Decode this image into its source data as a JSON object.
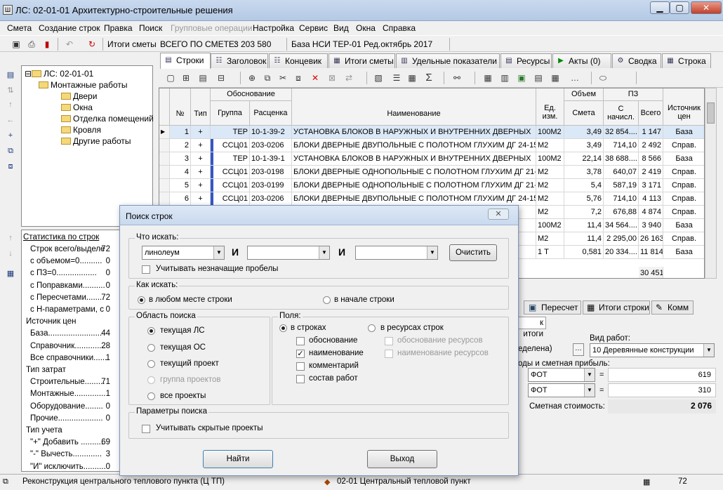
{
  "window": {
    "title": "ЛС: 02-01-01 Архитектурно-строительные решения"
  },
  "menu": [
    "Смета",
    "Создание строк",
    "Правка",
    "Поиск",
    "Групповые операции",
    "Настройка",
    "Сервис",
    "Вид",
    "Окна",
    "Справка"
  ],
  "toolbar": {
    "totals_label": "Итоги сметы",
    "total_caption": "ВСЕГО ПО СМЕТЕ:",
    "total_value": "3 203 580",
    "base_label": "База НСИ",
    "base_value": "ТЕР-01 Ред.октябрь 2017"
  },
  "tabs": [
    "Строки",
    "Заголовок",
    "Концевик",
    "Итоги сметы",
    "Удельные показатели",
    "Ресурсы",
    "Акты (0)",
    "Сводка",
    "Строка"
  ],
  "tree": {
    "root": "ЛС: 02-01-01",
    "group": "Монтажные работы",
    "items": [
      "Двери",
      "Окна",
      "Отделка помещений",
      "Кровля",
      "Другие работы"
    ]
  },
  "stats": {
    "title": "Статистика по строк",
    "rows": [
      {
        "label": "Строк всего/выделе",
        "value": "72"
      },
      {
        "label": "с объемом=0..........",
        "value": "0"
      },
      {
        "label": "с ПЗ=0..................",
        "value": "0"
      },
      {
        "label": "с Поправками..........",
        "value": "0"
      },
      {
        "label": "с Пересчетами........",
        "value": "72"
      },
      {
        "label": "с Н-параметрами, с",
        "value": "0"
      },
      {
        "label": "Источник цен",
        "value": ""
      },
      {
        "label": "База........................",
        "value": "44"
      },
      {
        "label": "Справочник..............",
        "value": "28"
      },
      {
        "label": "Все справочники......",
        "value": "1"
      },
      {
        "label": "Тип затрат",
        "value": ""
      },
      {
        "label": "Строительные.........",
        "value": "71"
      },
      {
        "label": "Монтажные..............",
        "value": "1"
      },
      {
        "label": "Оборудование........",
        "value": "0"
      },
      {
        "label": "Прочие....................",
        "value": "0"
      },
      {
        "label": "Тип учета",
        "value": ""
      },
      {
        "label": "\"+\" Добавить ..........",
        "value": "69"
      },
      {
        "label": "\"-\" Вычесть.............",
        "value": "3"
      },
      {
        "label": "\"И\" исключить..........",
        "value": "0"
      }
    ]
  },
  "grid": {
    "headers": {
      "basis": "Обоснование",
      "volume": "Объем",
      "pz": "ПЗ",
      "num": "№",
      "type": "Тип",
      "group": "Группа",
      "rate": "Расценка",
      "name": "Наименование",
      "unit": "Ед. изм.",
      "smeta": "Смета",
      "accrued": "С начисл.",
      "total": "Всего",
      "source": "Источник цен"
    },
    "rows": [
      {
        "n": "1",
        "t": "+",
        "g": "ТЕР",
        "r": "10-1-39-2",
        "name": "УСТАНОВКА БЛОКОВ В НАРУЖНЫХ И ВНУТРЕННИХ ДВЕРНЫХ",
        "u": "100М2",
        "v": "3,49",
        "a": "32 854....",
        "tot": "1 147",
        "s": "База"
      },
      {
        "n": "2",
        "t": "+",
        "g": "ССЦ01",
        "r": "203-0206",
        "name": "БЛОКИ ДВЕРНЫЕ ДВУПОЛЬНЫЕ С ПОЛОТНОМ ГЛУХИМ ДГ 24-15,",
        "u": "М2",
        "v": "3,49",
        "a": "714,10",
        "tot": "2 492",
        "s": "Справ."
      },
      {
        "n": "3",
        "t": "+",
        "g": "ТЕР",
        "r": "10-1-39-1",
        "name": "УСТАНОВКА БЛОКОВ В НАРУЖНЫХ И ВНУТРЕННИХ ДВЕРНЫХ",
        "u": "100М2",
        "v": "22,14",
        "a": "38 688....",
        "tot": "8 566",
        "s": "База"
      },
      {
        "n": "4",
        "t": "+",
        "g": "ССЦ01",
        "r": "203-0198",
        "name": "БЛОКИ ДВЕРНЫЕ ОДНОПОЛЬНЫЕ С ПОЛОТНОМ ГЛУХИМ ДГ 21-6,",
        "u": "М2",
        "v": "3,78",
        "a": "640,07",
        "tot": "2 419",
        "s": "Справ."
      },
      {
        "n": "5",
        "t": "+",
        "g": "ССЦ01",
        "r": "203-0199",
        "name": "БЛОКИ ДВЕРНЫЕ ОДНОПОЛЬНЫЕ С ПОЛОТНОМ ГЛУХИМ ДГ 21-9,",
        "u": "М2",
        "v": "5,4",
        "a": "587,19",
        "tot": "3 171",
        "s": "Справ."
      },
      {
        "n": "6",
        "t": "+",
        "g": "ССЦ01",
        "r": "203-0206",
        "name": "БЛОКИ ДВЕРНЫЕ ДВУПОЛЬНЫЕ С ПОЛОТНОМ ГЛУХИМ ДГ 24-15,",
        "u": "М2",
        "v": "5,76",
        "a": "714,10",
        "tot": "4 113",
        "s": "Справ."
      },
      {
        "n": "",
        "t": "",
        "g": "",
        "r": "",
        "name": "",
        "u": "М2",
        "v": "7,2",
        "a": "676,88",
        "tot": "4 874",
        "s": "Справ."
      },
      {
        "n": "",
        "t": "",
        "g": "",
        "r": "",
        "name": "",
        "u": "100М2",
        "v": "11,4",
        "a": "34 564....",
        "tot": "3 940",
        "s": "База"
      },
      {
        "n": "",
        "t": "",
        "g": "",
        "r": "",
        "name": "",
        "u": "М2",
        "v": "11,4",
        "a": "2 295,00",
        "tot": "26 163",
        "s": "Справ."
      },
      {
        "n": "",
        "t": "",
        "g": "",
        "r": "",
        "name": "",
        "u": "1 Т",
        "v": "0,581",
        "a": "20 334....",
        "tot": "11 814",
        "s": "База"
      }
    ],
    "footer_total": "30 451"
  },
  "lower": {
    "tabs": [
      "Пересчет",
      "Итоги строки",
      "Комм"
    ],
    "subtab": "к итоги",
    "allocated": "еделена)",
    "work_type_label": "Вид работ:",
    "work_type_value": "10 Деревянные конструкции",
    "overhead_label": "оды и сметная прибыль:",
    "fot1": "ФОТ",
    "val1": "619",
    "fot2": "ФОТ",
    "val2": "310",
    "cost_label": "Сметная стоимость:",
    "cost_value": "2 076"
  },
  "status": {
    "project": "Реконструкция центрального теплового пункта (Ц ТП)",
    "object": "02-01 Центральный тепловой пункт",
    "count": "72"
  },
  "dialog": {
    "title": "Поиск строк",
    "what_label": "Что искать:",
    "term1": "линолеум",
    "and1": "И",
    "and2": "И",
    "clear": "Очистить",
    "ignore_spaces": "Учитывать незначащие пробелы",
    "how_label": "Как искать:",
    "how_anywhere": "в любом месте строки",
    "how_start": "в начале строки",
    "area_label": "Область поиска",
    "area_options": [
      "текущая ЛС",
      "текущая ОС",
      "текущий проект",
      "группа проектов",
      "все проекты"
    ],
    "fields_label": "Поля:",
    "in_rows": "в строках",
    "in_resources": "в ресурсах строк",
    "row_fields": [
      {
        "label": "обоснование",
        "checked": false
      },
      {
        "label": "наименование",
        "checked": true
      },
      {
        "label": "комментарий",
        "checked": false
      },
      {
        "label": "состав работ",
        "checked": false
      }
    ],
    "res_fields": [
      "обоснование ресурсов",
      "наименование ресурсов"
    ],
    "params_label": "Параметры поиска",
    "hidden_projects": "Учитывать скрытые проекты",
    "find": "Найти",
    "exit": "Выход"
  }
}
